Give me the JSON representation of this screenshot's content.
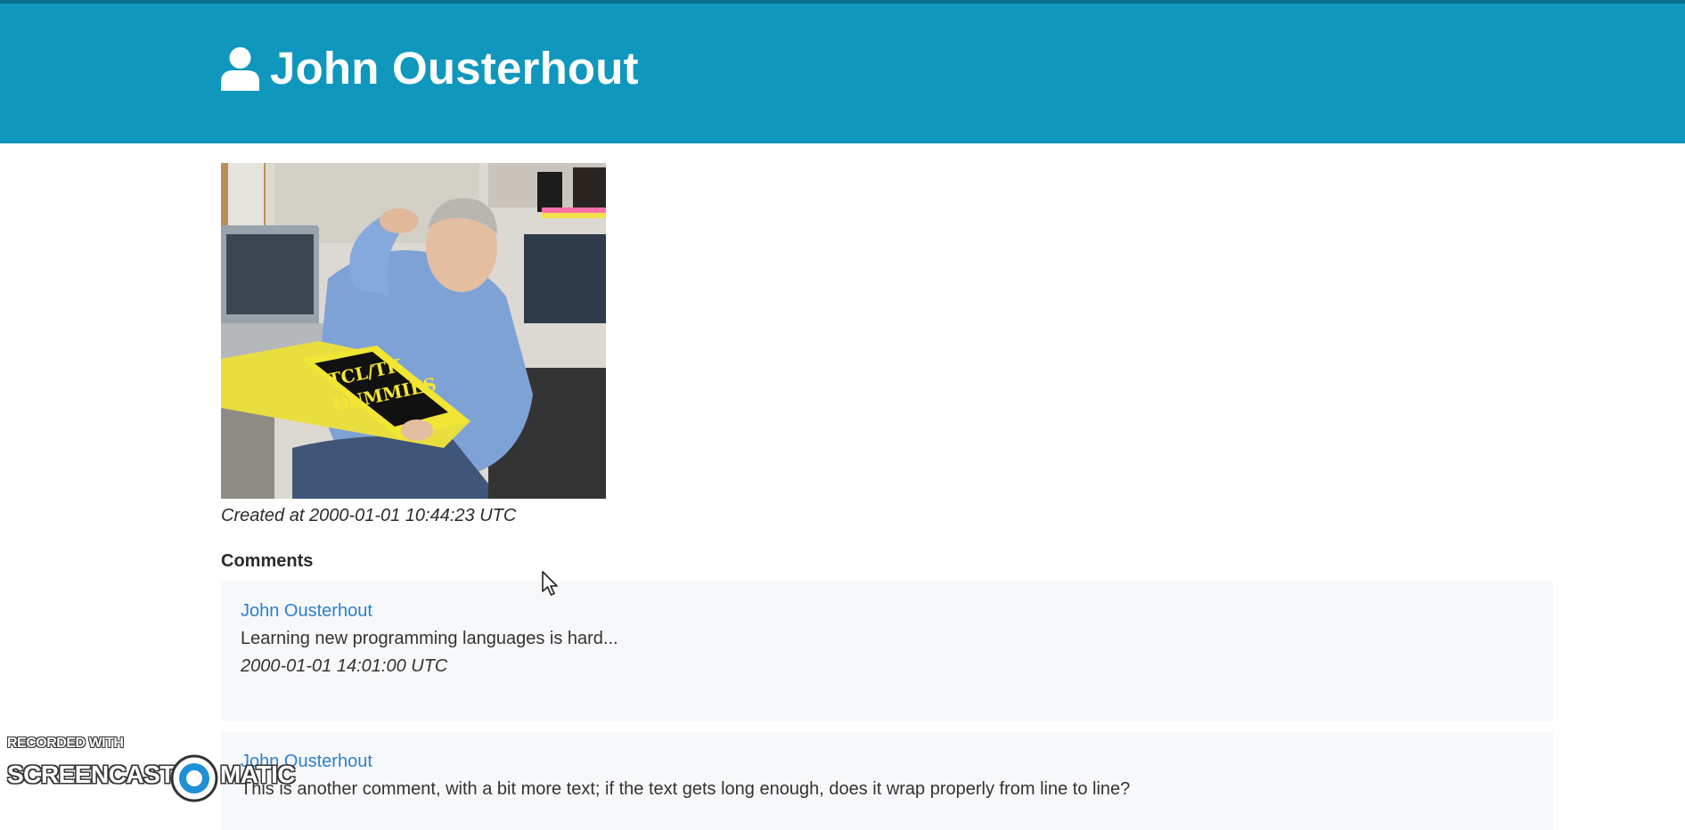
{
  "header": {
    "title": "John Ousterhout",
    "background_color": "#0f97bd",
    "icon": "user-icon"
  },
  "post": {
    "image_alt": "John Ousterhout reading a Tcl/Tk for Dummies book",
    "book_title_line1": "TCL/TK",
    "book_title_line2": "DUMMIES",
    "created": "Created at 2000-01-01 10:44:23 UTC"
  },
  "comments": {
    "heading": "Comments",
    "items": [
      {
        "author": "John Ousterhout",
        "text": "Learning new programming languages is hard...",
        "time": "2000-01-01 14:01:00 UTC"
      },
      {
        "author": "John Ousterhout",
        "text": "This is another comment, with a bit more text; if the text gets long enough, does it wrap properly from line to line?"
      }
    ]
  },
  "watermark": {
    "line1": "RECORDED WITH",
    "left": "SCREENCAST",
    "right": "MATIC"
  },
  "colors": {
    "accent": "#0f97bd",
    "link": "#2d7fcf",
    "comment_bg": "#f7f8fa"
  }
}
